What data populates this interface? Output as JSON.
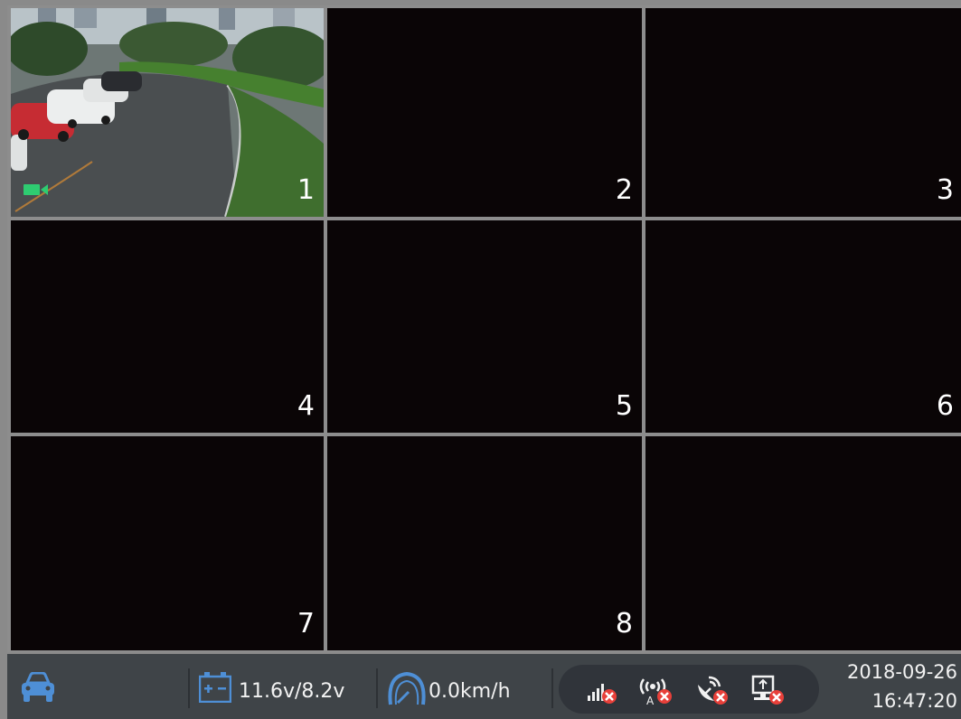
{
  "channels": [
    {
      "number": "1",
      "has_video": true,
      "recording_icon": "camera-recording-icon"
    },
    {
      "number": "2",
      "has_video": false
    },
    {
      "number": "3",
      "has_video": false
    },
    {
      "number": "4",
      "has_video": false
    },
    {
      "number": "5",
      "has_video": false
    },
    {
      "number": "6",
      "has_video": false
    },
    {
      "number": "7",
      "has_video": false
    },
    {
      "number": "8",
      "has_video": false
    },
    {
      "number": "",
      "has_video": false
    }
  ],
  "status_bar": {
    "vehicle_icon": "car-icon",
    "battery_icon": "battery-icon",
    "voltage": "11.6v/8.2v",
    "speed_icon": "speedometer-icon",
    "speed": "0.0km/h",
    "signal_icons": [
      "cellular-signal-icon",
      "wifi-ap-icon",
      "gps-icon",
      "server-upload-icon"
    ],
    "date": "2018-09-26",
    "time": "16:47:20"
  },
  "colors": {
    "accent_blue": "#4e8fd6",
    "status_error_red": "#e8403a",
    "recording_green": "#2ecc71",
    "status_bar_bg": "#3f4448"
  }
}
